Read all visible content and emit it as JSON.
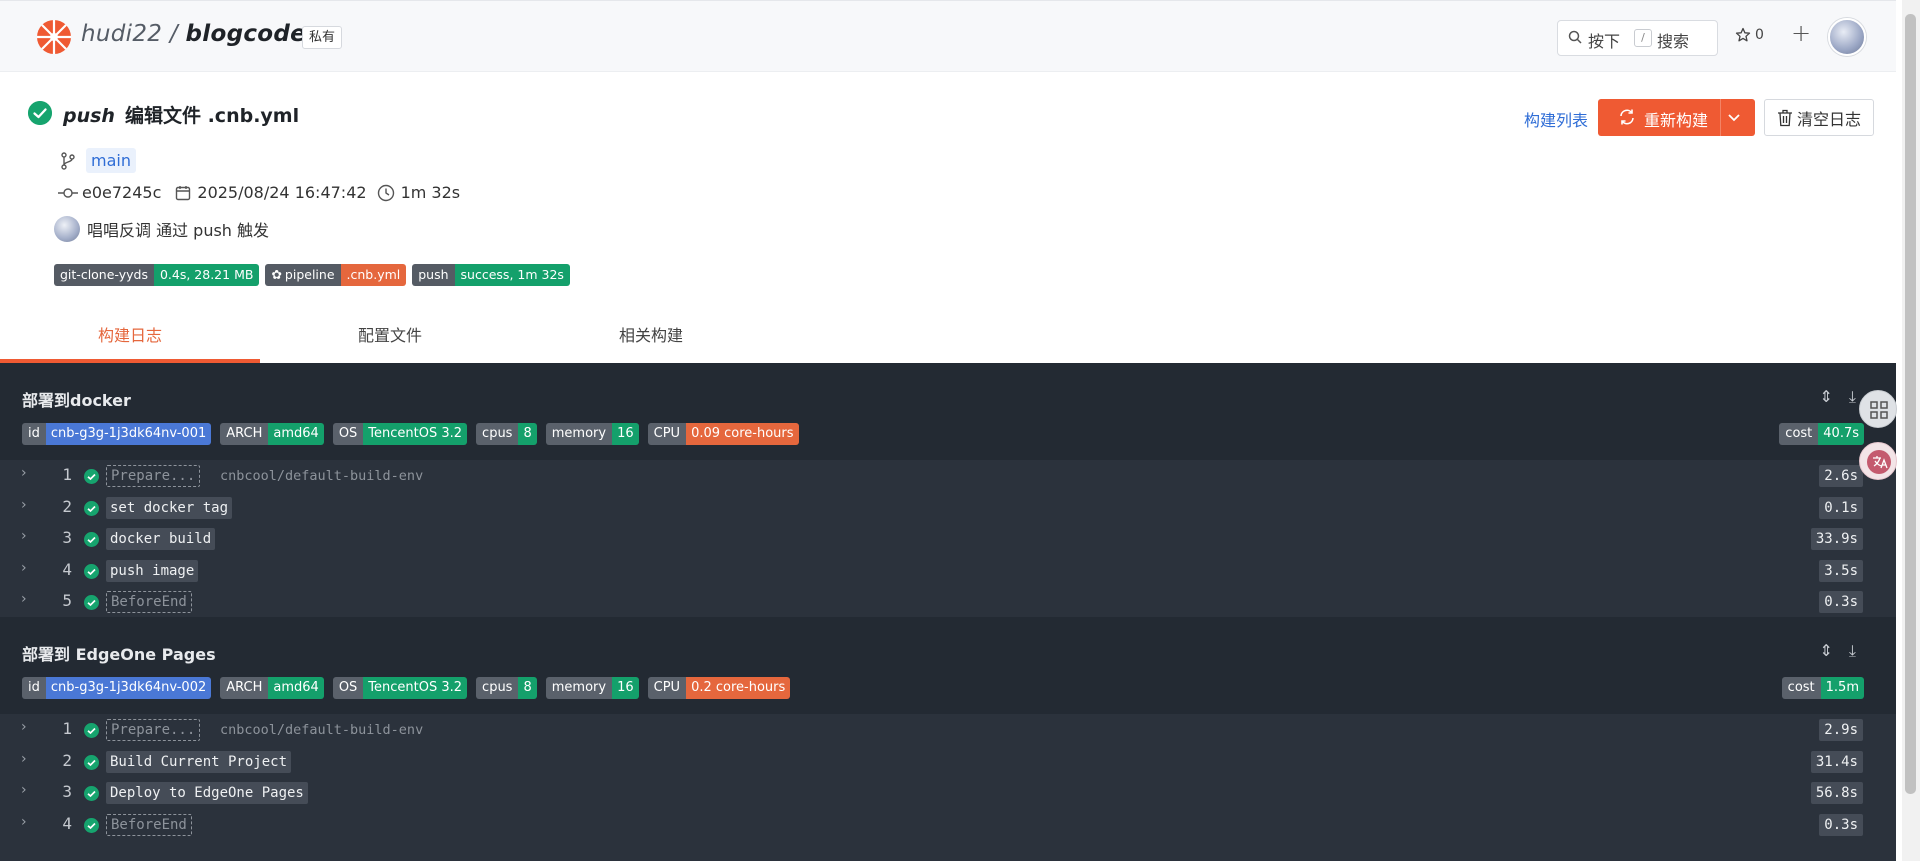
{
  "header": {
    "owner": "hudi22",
    "separator": "/",
    "repo": "blogcode",
    "visibility": "私有",
    "search_prefix": "按下",
    "search_key": "/",
    "search_label": "搜索",
    "star_count": "0"
  },
  "build": {
    "event": "push",
    "title": "编辑文件 .cnb.yml",
    "branch": "main",
    "commit": "e0e7245c",
    "date": "2025/08/24 16:47:42",
    "duration": "1m 32s",
    "trigger": "唱唱反调 通过 push 触发",
    "badges": [
      {
        "label": "git-clone-yyds",
        "value": "0.4s, 28.21 MB",
        "color": "#14a06b"
      },
      {
        "label": "pipeline",
        "value": ".cnb.yml",
        "color": "#e5673d"
      },
      {
        "label": "push",
        "value": "success, 1m 32s",
        "color": "#14a06b"
      }
    ]
  },
  "actions": {
    "build_list": "构建列表",
    "rebuild": "重新构建",
    "clear_log": "清空日志"
  },
  "tabs": [
    "构建日志",
    "配置文件",
    "相关构建"
  ],
  "stages": [
    {
      "title": "部署到docker",
      "badges": [
        {
          "label": "id",
          "value": "cnb-g3g-1j3dk64nv-001",
          "color": "#4a78d6"
        },
        {
          "label": "ARCH",
          "value": "amd64",
          "color": "#14a06b"
        },
        {
          "label": "OS",
          "value": "TencentOS 3.2",
          "color": "#14a06b"
        },
        {
          "label": "cpus",
          "value": "8",
          "color": "#14a06b"
        },
        {
          "label": "memory",
          "value": "16",
          "color": "#14a06b"
        },
        {
          "label": "CPU",
          "value": "0.09 core-hours",
          "color": "#e5673d"
        }
      ],
      "cost": {
        "label": "cost",
        "value": "40.7s"
      },
      "steps": [
        {
          "num": "1",
          "name": "Prepare...",
          "dashed": true,
          "image": "cnbcool/default-build-env",
          "duration": "2.6s"
        },
        {
          "num": "2",
          "name": "set docker tag",
          "dashed": false,
          "image": "",
          "duration": "0.1s"
        },
        {
          "num": "3",
          "name": "docker build",
          "dashed": false,
          "image": "",
          "duration": "33.9s"
        },
        {
          "num": "4",
          "name": "push image",
          "dashed": false,
          "image": "",
          "duration": "3.5s"
        },
        {
          "num": "5",
          "name": "BeforeEnd",
          "dashed": true,
          "image": "",
          "duration": "0.3s"
        }
      ]
    },
    {
      "title": "部署到 EdgeOne Pages",
      "badges": [
        {
          "label": "id",
          "value": "cnb-g3g-1j3dk64nv-002",
          "color": "#4a78d6"
        },
        {
          "label": "ARCH",
          "value": "amd64",
          "color": "#14a06b"
        },
        {
          "label": "OS",
          "value": "TencentOS 3.2",
          "color": "#14a06b"
        },
        {
          "label": "cpus",
          "value": "8",
          "color": "#14a06b"
        },
        {
          "label": "memory",
          "value": "16",
          "color": "#14a06b"
        },
        {
          "label": "CPU",
          "value": "0.2 core-hours",
          "color": "#e5673d"
        }
      ],
      "cost": {
        "label": "cost",
        "value": "1.5m"
      },
      "steps": [
        {
          "num": "1",
          "name": "Prepare...",
          "dashed": true,
          "image": "cnbcool/default-build-env",
          "duration": "2.9s"
        },
        {
          "num": "2",
          "name": "Build Current Project",
          "dashed": false,
          "image": "",
          "duration": "31.4s"
        },
        {
          "num": "3",
          "name": "Deploy to EdgeOne Pages",
          "dashed": false,
          "image": "",
          "duration": "56.8s"
        },
        {
          "num": "4",
          "name": "BeforeEnd",
          "dashed": true,
          "image": "",
          "duration": "0.3s"
        }
      ]
    }
  ]
}
